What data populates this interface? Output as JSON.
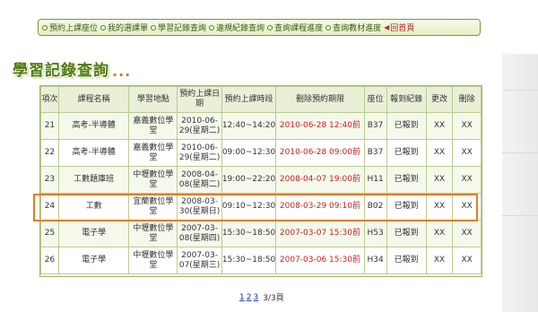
{
  "nav": {
    "items": [
      "預約上課座位",
      "我的選課單",
      "學習記錄查詢",
      "違規紀錄查詢",
      "查詢課程進度",
      "查詢教材進度"
    ],
    "home_label": "回首頁",
    "home_arrow": "◀"
  },
  "heading": {
    "title": "學習記錄查詢",
    "dots": "..."
  },
  "table": {
    "headers": [
      "項次",
      "課程名稱",
      "學習地點",
      "預約上課日期",
      "預約上課時段",
      "刪除預約期限",
      "座位",
      "報到紀錄",
      "更改",
      "刪除"
    ],
    "rows": [
      {
        "no": "21",
        "course": "高考-半導體",
        "place": "嘉義數位學堂",
        "date": "2010-06-29(星期二)",
        "time": "12:40~14:20",
        "deadline": "2010-06-28 12:40前",
        "seat": "B37",
        "checkin": "已報到",
        "edit": "XX",
        "del": "XX"
      },
      {
        "no": "22",
        "course": "高考-半導體",
        "place": "嘉義數位學堂",
        "date": "2010-06-29(星期二)",
        "time": "09:00~12:30",
        "deadline": "2010-06-28 09:00前",
        "seat": "B37",
        "checkin": "已報到",
        "edit": "XX",
        "del": "XX"
      },
      {
        "no": "23",
        "course": "工數題庫班",
        "place": "中壢數位學堂",
        "date": "2008-04-08(星期二)",
        "time": "19:00~22:20",
        "deadline": "2008-04-07 19:00前",
        "seat": "H11",
        "checkin": "已報到",
        "edit": "XX",
        "del": "XX"
      },
      {
        "no": "24",
        "course": "工數",
        "place": "宜蘭數位學堂",
        "date": "2008-03-30(星期日)",
        "time": "09:10~12:30",
        "deadline": "2008-03-29 09:10前",
        "seat": "B02",
        "checkin": "已報到",
        "edit": "XX",
        "del": "XX"
      },
      {
        "no": "25",
        "course": "電子學",
        "place": "中壢數位學堂",
        "date": "2007-03-08(星期四)",
        "time": "15:30~18:50",
        "deadline": "2007-03-07 15:30前",
        "seat": "H53",
        "checkin": "已報到",
        "edit": "XX",
        "del": "XX"
      },
      {
        "no": "26",
        "course": "電子學",
        "place": "中壢數位學堂",
        "date": "2007-03-07(星期三)",
        "time": "15:30~18:50",
        "deadline": "2007-03-06 15:30前",
        "seat": "H34",
        "checkin": "已報到",
        "edit": "XX",
        "del": "XX"
      }
    ]
  },
  "pager": {
    "pages": [
      "1",
      "2",
      "3"
    ],
    "current": "3",
    "summary": "3/3頁"
  },
  "colors": {
    "accent_green": "#4f7a0e",
    "highlight": "#ee7a1a",
    "deadline_red": "#cc1f1f"
  }
}
